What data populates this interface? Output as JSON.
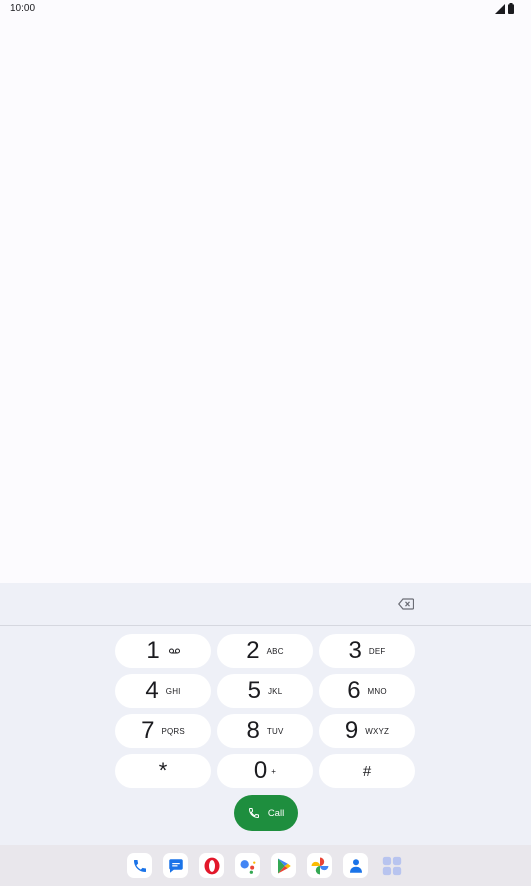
{
  "status_bar": {
    "time": "10:00",
    "icons": [
      "signal-icon",
      "battery-icon"
    ]
  },
  "dialpad": {
    "number": "",
    "keys": [
      {
        "digit": "1",
        "letters": "",
        "icon": "voicemail-icon"
      },
      {
        "digit": "2",
        "letters": "ABC"
      },
      {
        "digit": "3",
        "letters": "DEF"
      },
      {
        "digit": "4",
        "letters": "GHI"
      },
      {
        "digit": "5",
        "letters": "JKL"
      },
      {
        "digit": "6",
        "letters": "MNO"
      },
      {
        "digit": "7",
        "letters": "PQRS"
      },
      {
        "digit": "8",
        "letters": "TUV"
      },
      {
        "digit": "9",
        "letters": "WXYZ"
      },
      {
        "digit": "*",
        "letters": ""
      },
      {
        "digit": "0",
        "letters": "+"
      },
      {
        "digit": "#",
        "letters": ""
      }
    ],
    "call_label": "Call"
  },
  "dock": {
    "apps": [
      "phone-icon",
      "messages-icon",
      "opera-icon",
      "assistant-icon",
      "play-store-icon",
      "photos-icon",
      "contacts-icon",
      "app-drawer-icon"
    ]
  },
  "colors": {
    "accent_green": "#1e8e3e",
    "panel_bg": "#eef0f7",
    "dock_bg": "#e9e7ec"
  }
}
